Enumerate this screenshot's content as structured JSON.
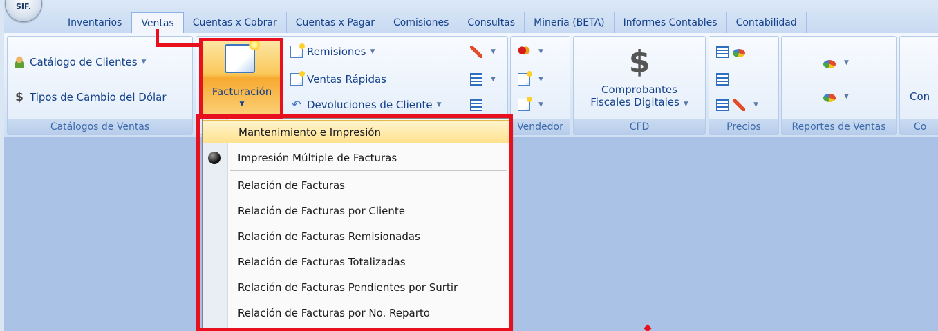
{
  "app": {
    "orb_label": "SIF."
  },
  "tabs": [
    "Inventarios",
    "Ventas",
    "Cuentas x Cobrar",
    "Cuentas x Pagar",
    "Comisiones",
    "Consultas",
    "Mineria (BETA)",
    "Informes Contables",
    "Contabilidad"
  ],
  "active_tab": "Ventas",
  "ribbon": {
    "catalogos": {
      "catalogo_clientes": "Catálogo de Clientes",
      "tipos_cambio": "Tipos de Cambio del Dólar",
      "label": "Catálogos de Ventas"
    },
    "facturacion": {
      "label": "Facturación"
    },
    "ventas_items": {
      "remisiones": "Remisiones",
      "ventas_rapidas": "Ventas Rápidas",
      "devoluciones": "Devoluciones de Cliente"
    },
    "vendedor": {
      "label": "Vendedor"
    },
    "cfd": {
      "button_line1": "Comprobantes",
      "button_line2": "Fiscales Digitales",
      "label": "CFD"
    },
    "precios": {
      "label": "Precios"
    },
    "reportes": {
      "label": "Reportes de Ventas"
    },
    "partial": {
      "button": "Con",
      "label": "Co"
    }
  },
  "menu": {
    "items": [
      "Mantenimiento e Impresión",
      "Impresión Múltiple de Facturas",
      "Relación de Facturas",
      "Relación de Facturas por Cliente",
      "Relación de Facturas Remisionadas",
      "Relación de Facturas Totalizadas",
      "Relación de Facturas Pendientes por Surtir",
      "Relación de Facturas por No. Reparto"
    ],
    "highlighted_index": 0
  },
  "colors": {
    "annotation": "#e8101e",
    "highlight": "#ffe28f",
    "workspace": "#a9c2e6"
  }
}
